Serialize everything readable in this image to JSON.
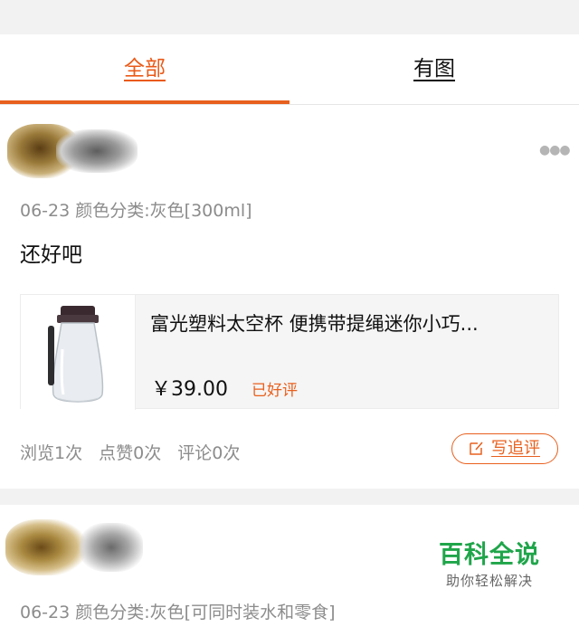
{
  "tabs": [
    {
      "label": "全部",
      "active": true
    },
    {
      "label": "有图",
      "active": false
    }
  ],
  "reviews": [
    {
      "meta": "06-23 颜色分类:灰色[300ml]",
      "content": "还好吧",
      "product": {
        "name": "富光塑料太空杯 便携带提绳迷你小巧...",
        "price": "￥39.00",
        "badge": "已好评"
      },
      "stats": {
        "views": "浏览1次",
        "likes": "点赞0次",
        "comments": "评论0次"
      },
      "followup_label": "写追评"
    },
    {
      "meta": "06-23 颜色分类:灰色[可同时装水和零食]"
    }
  ],
  "watermark": {
    "title": "百科全说",
    "subtitle": "助你轻松解决"
  },
  "colors": {
    "accent": "#e8601e",
    "page_bg": "#f2f2f2",
    "muted_text": "#8c8c8c",
    "watermark_green": "#1fa54a"
  }
}
